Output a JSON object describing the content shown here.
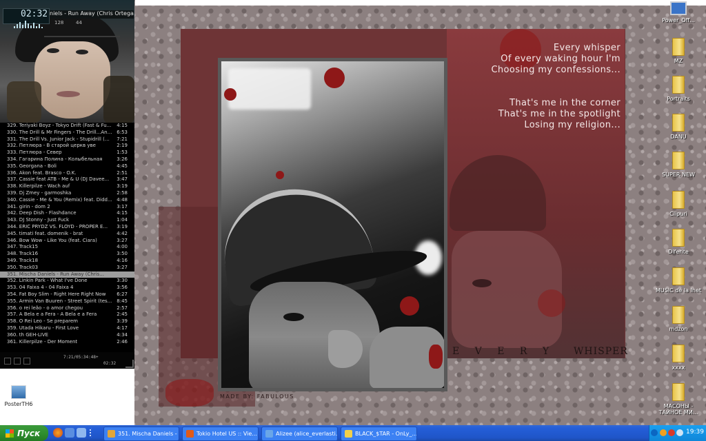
{
  "player": {
    "time": "02:32",
    "ticker": "niels - Run Away (Chris Ortega &",
    "kbps": "128",
    "khz": "44",
    "playlist": [
      {
        "t": "329. Teriyaki Boyz - Tokyo Drift (Fast & Fu...",
        "d": "4:15"
      },
      {
        "t": "330. The Drill & Mr Fingers - The Drill...And...",
        "d": "6:53"
      },
      {
        "t": "331. The Drill Vs. Junior Jack - Stupidrill (K...",
        "d": "7:21"
      },
      {
        "t": "332. Петлюра - В старой церкв уве",
        "d": "2:19"
      },
      {
        "t": "333. Петлюра - Север",
        "d": "1:53"
      },
      {
        "t": "334. Гагарина Полина - Колыбельная",
        "d": "3:26"
      },
      {
        "t": "335. Georgana - Boli",
        "d": "4:45"
      },
      {
        "t": "336. Akon feat. Brasco - O.K.",
        "d": "2:51"
      },
      {
        "t": "337. Cassie feat ATB - Me & U (DJ Davee...",
        "d": "3:47"
      },
      {
        "t": "338. Killerpilze - Wach auf",
        "d": "3:19"
      },
      {
        "t": "339. Dj Zmey - garmoshka",
        "d": "2:58"
      },
      {
        "t": "340. Cassie - Me & You (Remix) feat. Didd...",
        "d": "4:48"
      },
      {
        "t": "341. girin - dom 2",
        "d": "3:17"
      },
      {
        "t": "342. Deep Dish - Flashdance",
        "d": "4:15"
      },
      {
        "t": "343. DJ Stonny - Just Fuck",
        "d": "1:04"
      },
      {
        "t": "344. ERIC PRYDZ VS. FLOYD - PROPER E...",
        "d": "3:19"
      },
      {
        "t": "345. timati feat. domenik - brat",
        "d": "4:42"
      },
      {
        "t": "346. Bow Wow - Like You (feat. Ciara)",
        "d": "3:27"
      },
      {
        "t": "347. Track15",
        "d": "4:00"
      },
      {
        "t": "348. Track16",
        "d": "3:50"
      },
      {
        "t": "349. Track18",
        "d": "4:16"
      },
      {
        "t": "350. Track03",
        "d": "3:27"
      },
      {
        "t": "351. Mischa Daniels - Run Away (Chris...",
        "d": "",
        "sel": true
      },
      {
        "t": "352. Linkin Park - What I've Done",
        "d": "3:30"
      },
      {
        "t": "353. 04 Faixa 4 - 04 Faixa 4",
        "d": "3:56"
      },
      {
        "t": "354. Fat Boy Slim - Right Here Right Now",
        "d": "6:27"
      },
      {
        "t": "355. Armin Van Buuren - Street Spirit (tes...",
        "d": "8:45"
      },
      {
        "t": "356. o rei leão - o amor chegou",
        "d": "2:57"
      },
      {
        "t": "357. A Bela e a Fera - A Bela e a Fera",
        "d": "2:45"
      },
      {
        "t": "358. O Rei Leo - Se preparem",
        "d": "3:39"
      },
      {
        "t": "359. Utada Hikaru - First Love",
        "d": "4:17"
      },
      {
        "t": "360. th GEH-LIVE",
        "d": "4:34"
      },
      {
        "t": "361. Killerpilze - Der Moment",
        "d": "2:46"
      }
    ],
    "footer_time": "7:21/05:34:48+",
    "footer_time2": "02:32"
  },
  "wallpaper": {
    "lyrics1": [
      "Every whisper",
      "Of every waking hour I'm",
      "Choosing my confessions..."
    ],
    "lyrics2": [
      "That's me in the corner",
      "That's me in the spotlight",
      "Losing my religion..."
    ],
    "every": "E V E R Y",
    "whisper": "WHISPER",
    "made_by": "MADE BY: FABULOUS"
  },
  "desktop_icons": [
    {
      "label": "Power_Off...",
      "type": "monitor"
    },
    {
      "label": "MZ",
      "type": "folder"
    },
    {
      "label": "Portraits",
      "type": "folder"
    },
    {
      "label": "DANU",
      "type": "folder"
    },
    {
      "label": "SUPER NEW",
      "type": "folder"
    },
    {
      "label": "Clipuri",
      "type": "folder"
    },
    {
      "label": "Diferite",
      "type": "folder"
    },
    {
      "label": "MUSIC de la Inet",
      "type": "folder"
    },
    {
      "label": "mdzon",
      "type": "folder"
    },
    {
      "label": "xxxx",
      "type": "folder"
    },
    {
      "label": "МАСОНЫ - ТАЙНОЕ МИ...",
      "type": "folder"
    }
  ],
  "left_icon": {
    "label": "PosterTH6"
  },
  "taskbar": {
    "start_label": "Пуск",
    "tasks": [
      {
        "label": "351. Mischa Daniels - ...",
        "color": "#e2a63a"
      },
      {
        "label": "Tokio Hotel US :: Vie...",
        "color": "#e05a1a"
      },
      {
        "label": "Alizee (alice_everlasti...",
        "color": "#6aa6e8"
      },
      {
        "label": "BLACK_$TAR - OnLy_...",
        "color": "#f2d04a"
      }
    ],
    "clock": "19:39"
  }
}
